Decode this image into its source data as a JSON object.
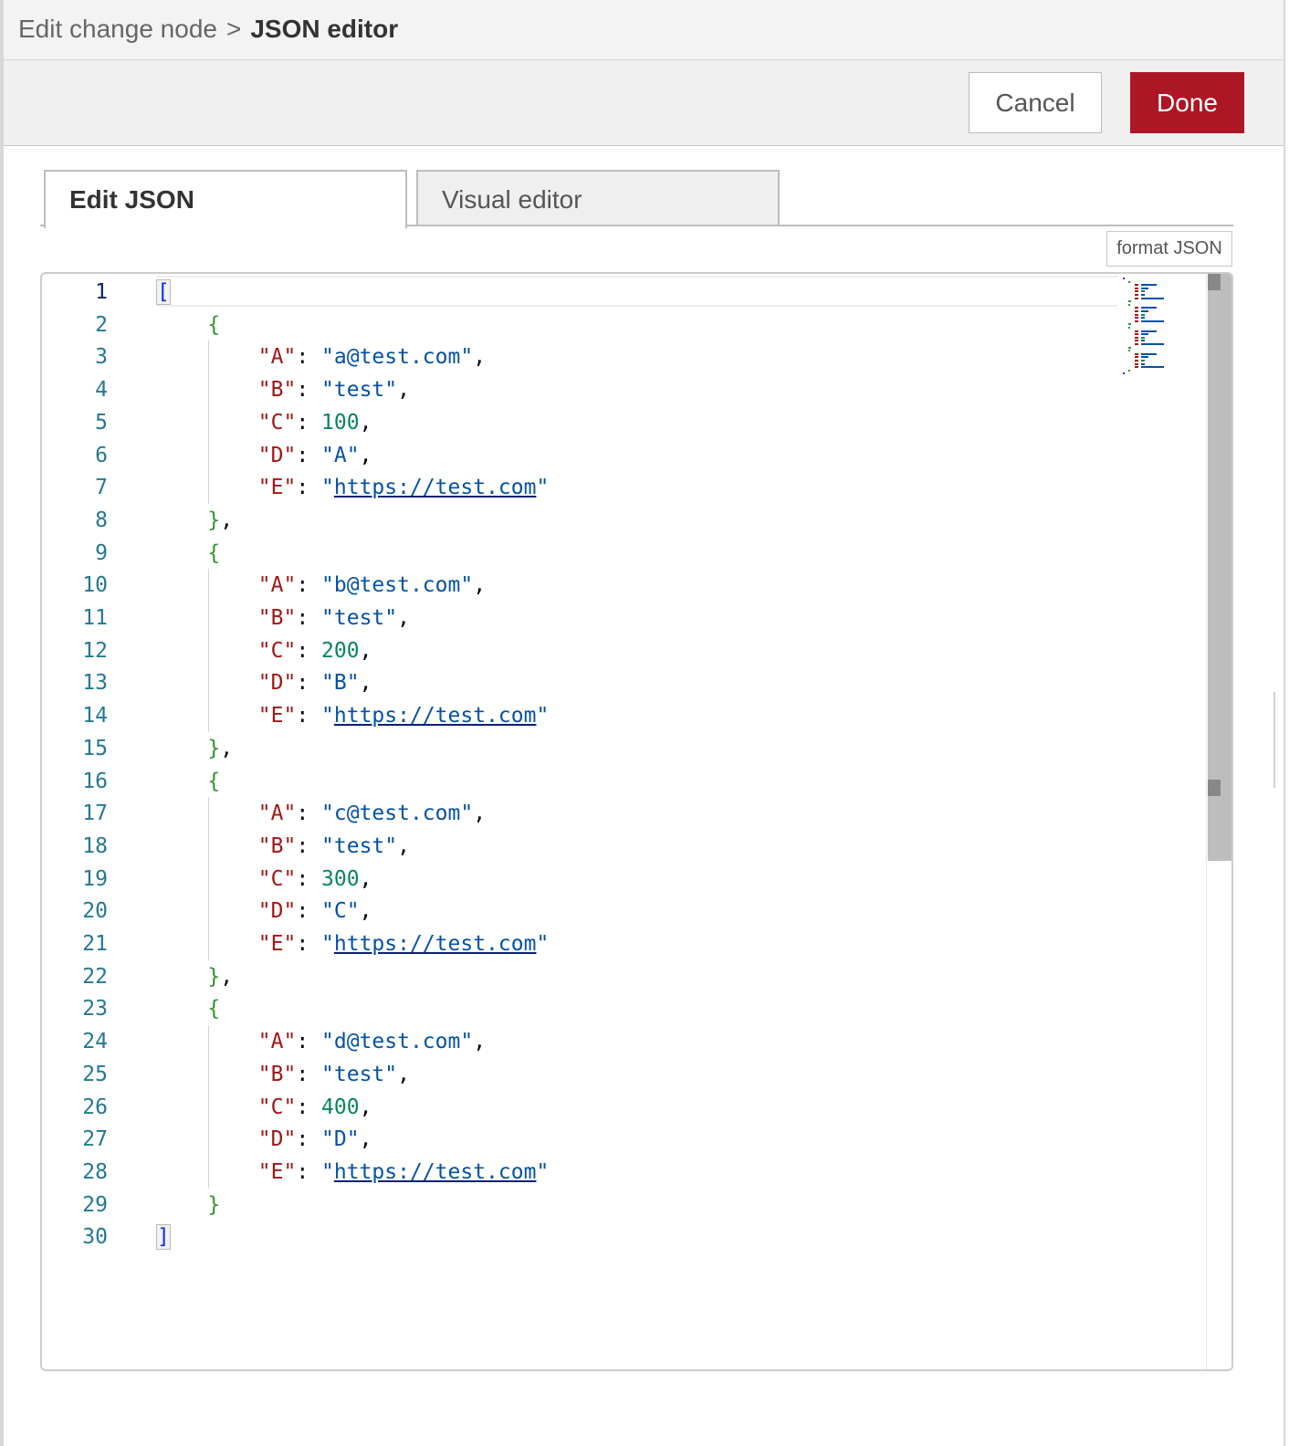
{
  "header": {
    "breadcrumb_parent": "Edit change node",
    "breadcrumb_separator": ">",
    "breadcrumb_current": "JSON editor"
  },
  "toolbar": {
    "cancel_label": "Cancel",
    "done_label": "Done"
  },
  "tabs": [
    {
      "label": "Edit JSON",
      "active": true
    },
    {
      "label": "Visual editor",
      "active": false
    }
  ],
  "format_button_label": "format JSON",
  "editor": {
    "current_line": 1,
    "line_numbers": [
      "1",
      "2",
      "3",
      "4",
      "5",
      "6",
      "7",
      "8",
      "9",
      "10",
      "11",
      "12",
      "13",
      "14",
      "15",
      "16",
      "17",
      "18",
      "19",
      "20",
      "21",
      "22",
      "23",
      "24",
      "25",
      "26",
      "27",
      "28",
      "29",
      "30"
    ],
    "content": "[\n    {\n        \"A\": \"a@test.com\",\n        \"B\": \"test\",\n        \"C\": 100,\n        \"D\": \"A\",\n        \"E\": \"https://test.com\"\n    },\n    {\n        \"A\": \"b@test.com\",\n        \"B\": \"test\",\n        \"C\": 200,\n        \"D\": \"B\",\n        \"E\": \"https://test.com\"\n    },\n    {\n        \"A\": \"c@test.com\",\n        \"B\": \"test\",\n        \"C\": 300,\n        \"D\": \"C\",\n        \"E\": \"https://test.com\"\n    },\n    {\n        \"A\": \"d@test.com\",\n        \"B\": \"test\",\n        \"C\": 400,\n        \"D\": \"D\",\n        \"E\": \"https://test.com\"\n    }\n]"
  },
  "colors": {
    "done_button": "#ad1625",
    "json_key": "#a31515",
    "json_string": "#0451a5",
    "json_number": "#098658",
    "line_number": "#237893",
    "outer_bracket": "#0431fa",
    "object_brace": "#319331"
  }
}
